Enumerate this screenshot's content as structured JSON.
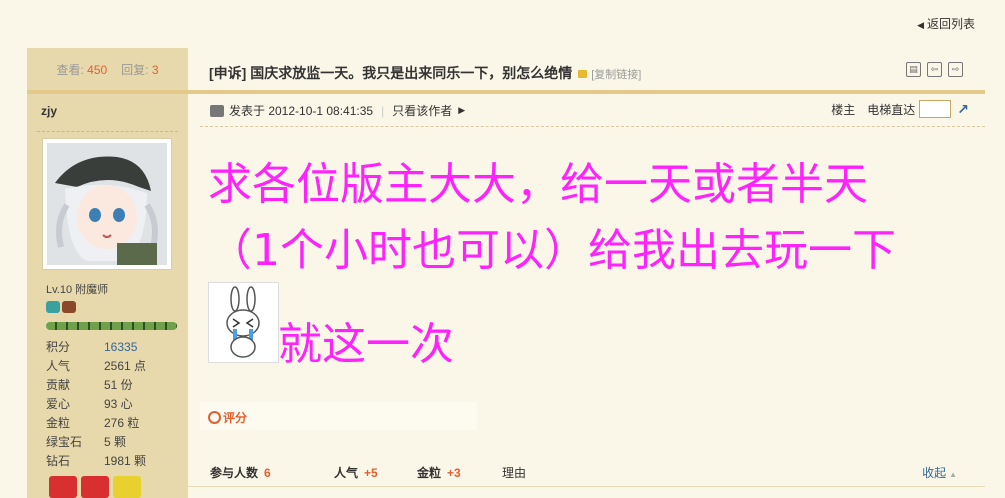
{
  "nav": {
    "back_label": "返回列表"
  },
  "stats": {
    "views_label": "查看:",
    "views": "450",
    "replies_label": "回复:",
    "replies": "3"
  },
  "user": {
    "name": "zjy",
    "level": "Lv.10 附魔师",
    "level_progress": 1.0,
    "profile": [
      {
        "key": "积分",
        "value": "16335"
      },
      {
        "key": "人气",
        "value": "2561 点"
      },
      {
        "key": "贡献",
        "value": "51 份"
      },
      {
        "key": "爱心",
        "value": "93 心"
      },
      {
        "key": "金粒",
        "value": "276 粒"
      },
      {
        "key": "绿宝石",
        "value": "5 颗"
      },
      {
        "key": "钻石",
        "value": "1981 颗"
      }
    ]
  },
  "thread": {
    "title": "[申诉] 国庆求放监一天。我只是出来同乐一下，别怎么绝情",
    "copy_link": "[复制链接]"
  },
  "post": {
    "posted_at": "发表于 2012-10-1 08:41:35",
    "author_only": "只看该作者",
    "floor": "楼主",
    "jump_label": "电梯直达",
    "lines": [
      "求各位版主大大，给一天或者半天",
      "（1个小时也可以）给我出去玩一下",
      "就这一次"
    ]
  },
  "rating": {
    "label": "评分",
    "participants_label": "参与人数",
    "participants": "6",
    "popularity_label": "人气",
    "popularity": "+5",
    "gold_label": "金粒",
    "gold": "+3",
    "reason_label": "理由",
    "collapse_label": "收起"
  },
  "colors": {
    "accent": "#e06030",
    "link": "#336699",
    "content_text": "#ff22ff"
  }
}
